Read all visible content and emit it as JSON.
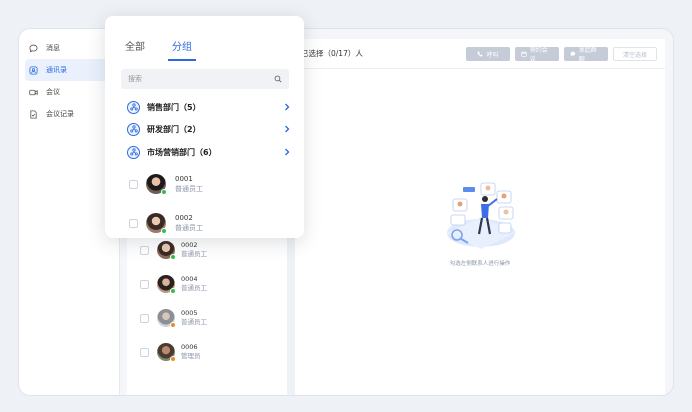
{
  "sidebar": {
    "items": [
      {
        "label": "消息",
        "icon": "chat-bubble-icon",
        "active": false
      },
      {
        "label": "通讯录",
        "icon": "contacts-icon",
        "active": true
      },
      {
        "label": "会议",
        "icon": "video-camera-icon",
        "active": false
      },
      {
        "label": "会议记录",
        "icon": "document-icon",
        "active": false
      }
    ]
  },
  "members_background": [
    {
      "id": "0002",
      "role": "普通员工",
      "status": "online"
    },
    {
      "id": "0004",
      "role": "普通员工",
      "status": "online"
    },
    {
      "id": "0005",
      "role": "普通员工",
      "status": "away"
    },
    {
      "id": "0006",
      "role": "管理员",
      "status": "away"
    }
  ],
  "content": {
    "selected_label": "已选择（0/17）人",
    "actions": [
      {
        "label": "呼叫",
        "icon": "phone-icon"
      },
      {
        "label": "预约会议",
        "icon": "calendar-icon"
      },
      {
        "label": "发起群聊",
        "icon": "group-chat-icon"
      }
    ],
    "clear_label": "清空选择",
    "empty_text": "勾选左侧联系人进行操作"
  },
  "popup": {
    "tabs": [
      {
        "label": "全部",
        "active": false
      },
      {
        "label": "分组",
        "active": true
      }
    ],
    "search": {
      "placeholder": "搜索",
      "value": ""
    },
    "groups": [
      {
        "label": "销售部门（5）"
      },
      {
        "label": "研发部门（2）"
      },
      {
        "label": "市场营销部门（6）"
      }
    ],
    "members": [
      {
        "id": "0001",
        "role": "普通员工",
        "status": "online"
      },
      {
        "id": "0002",
        "role": "普通员工",
        "status": "online"
      }
    ]
  },
  "colors": {
    "accent": "#2a6ae0",
    "online": "#2fbf4f",
    "away": "#f08a24",
    "disabled_button": "#c5ccd8"
  }
}
